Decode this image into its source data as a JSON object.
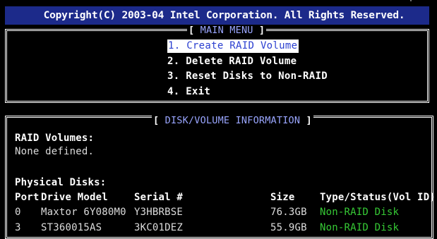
{
  "copyright": "Copyright(C) 2003-04 Intel Corporation.  All Rights Reserved.",
  "main_menu": {
    "title": "MAIN MENU",
    "items": [
      {
        "num": "1.",
        "label": "Create RAID Volume",
        "selected": true
      },
      {
        "num": "2.",
        "label": "Delete RAID Volume",
        "selected": false
      },
      {
        "num": "3.",
        "label": "Reset Disks to Non-RAID",
        "selected": false
      },
      {
        "num": "4.",
        "label": "Exit",
        "selected": false
      }
    ]
  },
  "disk_info": {
    "title": "DISK/VOLUME INFORMATION",
    "raid_volumes_label": "RAID Volumes:",
    "raid_volumes_value": "None defined.",
    "physical_disks_label": "Physical Disks:",
    "columns": {
      "port": "Port",
      "model": "Drive Model",
      "serial": "Serial #",
      "size": "Size",
      "status": "Type/Status(Vol ID)"
    },
    "disks": [
      {
        "port": "0",
        "model": "Maxtor 6Y080M0",
        "serial": "Y3HBRBSE",
        "size": "76.3GB",
        "status": "Non-RAID Disk"
      },
      {
        "port": "3",
        "model": "ST360015AS",
        "serial": "3KC01DEZ",
        "size": "55.9GB",
        "status": "Non-RAID Disk"
      }
    ]
  },
  "colors": {
    "background": "#000000",
    "title_bar": "#1c2a8a",
    "highlight_text": "#2b3fd0",
    "status_green": "#36c935"
  }
}
